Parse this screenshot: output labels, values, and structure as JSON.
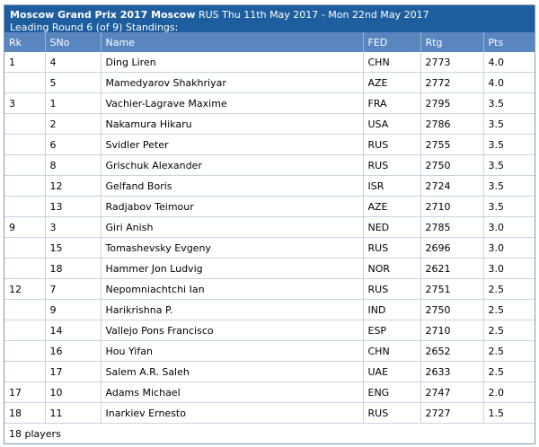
{
  "header": {
    "title": "Moscow Grand Prix 2017 Moscow",
    "details": "RUS Thu 11th May 2017 - Mon 22nd May 2017",
    "subtitle": "Leading Round 6 (of 9) Standings:"
  },
  "columns": [
    "Rk",
    "SNo",
    "Name",
    "FED",
    "Rtg",
    "Pts"
  ],
  "rows": [
    {
      "rk": "1",
      "sno": "4",
      "name": "Ding Liren",
      "fed": "CHN",
      "rtg": "2773",
      "pts": "4.0"
    },
    {
      "rk": "",
      "sno": "5",
      "name": "Mamedyarov Shakhriyar",
      "fed": "AZE",
      "rtg": "2772",
      "pts": "4.0"
    },
    {
      "rk": "3",
      "sno": "1",
      "name": "Vachier-Lagrave Maxime",
      "fed": "FRA",
      "rtg": "2795",
      "pts": "3.5"
    },
    {
      "rk": "",
      "sno": "2",
      "name": "Nakamura Hikaru",
      "fed": "USA",
      "rtg": "2786",
      "pts": "3.5"
    },
    {
      "rk": "",
      "sno": "6",
      "name": "Svidler Peter",
      "fed": "RUS",
      "rtg": "2755",
      "pts": "3.5"
    },
    {
      "rk": "",
      "sno": "8",
      "name": "Grischuk Alexander",
      "fed": "RUS",
      "rtg": "2750",
      "pts": "3.5"
    },
    {
      "rk": "",
      "sno": "12",
      "name": "Gelfand Boris",
      "fed": "ISR",
      "rtg": "2724",
      "pts": "3.5"
    },
    {
      "rk": "",
      "sno": "13",
      "name": "Radjabov Teimour",
      "fed": "AZE",
      "rtg": "2710",
      "pts": "3.5"
    },
    {
      "rk": "9",
      "sno": "3",
      "name": "Giri Anish",
      "fed": "NED",
      "rtg": "2785",
      "pts": "3.0"
    },
    {
      "rk": "",
      "sno": "15",
      "name": "Tomashevsky Evgeny",
      "fed": "RUS",
      "rtg": "2696",
      "pts": "3.0"
    },
    {
      "rk": "",
      "sno": "18",
      "name": "Hammer Jon Ludvig",
      "fed": "NOR",
      "rtg": "2621",
      "pts": "3.0"
    },
    {
      "rk": "12",
      "sno": "7",
      "name": "Nepomniachtchi Ian",
      "fed": "RUS",
      "rtg": "2751",
      "pts": "2.5"
    },
    {
      "rk": "",
      "sno": "9",
      "name": "Harikrishna P.",
      "fed": "IND",
      "rtg": "2750",
      "pts": "2.5"
    },
    {
      "rk": "",
      "sno": "14",
      "name": "Vallejo Pons Francisco",
      "fed": "ESP",
      "rtg": "2710",
      "pts": "2.5"
    },
    {
      "rk": "",
      "sno": "16",
      "name": "Hou Yifan",
      "fed": "CHN",
      "rtg": "2652",
      "pts": "2.5"
    },
    {
      "rk": "",
      "sno": "17",
      "name": "Salem A.R. Saleh",
      "fed": "UAE",
      "rtg": "2633",
      "pts": "2.5"
    },
    {
      "rk": "17",
      "sno": "10",
      "name": "Adams Michael",
      "fed": "ENG",
      "rtg": "2747",
      "pts": "2.0"
    },
    {
      "rk": "18",
      "sno": "11",
      "name": "Inarkiev Ernesto",
      "fed": "RUS",
      "rtg": "2727",
      "pts": "1.5"
    }
  ],
  "footer": "18 players",
  "colors": {
    "caption_bg": "#1f5e9e",
    "header_bg": "#5a86c0"
  }
}
